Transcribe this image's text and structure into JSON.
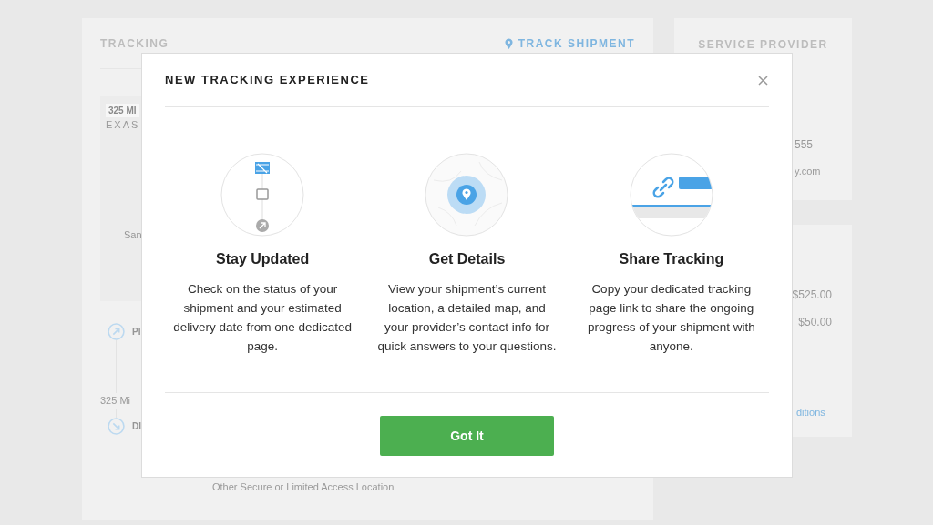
{
  "background": {
    "tracking_card": {
      "title": "TRACKING",
      "track_link": "TRACK SHIPMENT",
      "map": {
        "distance_badge": "325 MI",
        "region": "EXAS",
        "city": "San"
      },
      "stops": [
        {
          "kind": "pickup",
          "label": "PI"
        },
        {
          "kind": "delivery",
          "label": "DI"
        }
      ],
      "distance": "325 Mi",
      "location_type": "Other Secure or Limited Access Location"
    },
    "provider_card": {
      "title": "SERVICE PROVIDER",
      "phone": "555",
      "email": "y.com"
    },
    "price_card": {
      "lines": [
        "$525.00",
        "$50.00"
      ],
      "terms_link": "ditions"
    }
  },
  "modal": {
    "title": "NEW TRACKING EXPERIENCE",
    "features": [
      {
        "kind": "timeline",
        "title": "Stay Updated",
        "text": "Check on the status of your shipment and your estimated delivery date from one dedicated page."
      },
      {
        "kind": "map",
        "title": "Get Details",
        "text": "View your shipment’s current location, a detailed map, and your provider’s contact info for quick answers to your questions."
      },
      {
        "kind": "link",
        "title": "Share Tracking",
        "text": "Copy your dedicated tracking page link to share the ongoing progress of your shipment with anyone."
      }
    ],
    "button": "Got It"
  }
}
